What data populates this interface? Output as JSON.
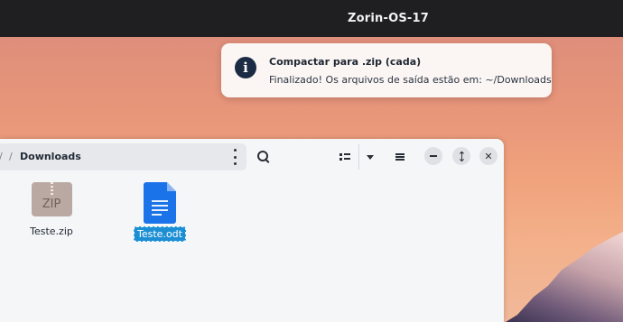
{
  "topbar": {
    "title": "Zorin-OS-17"
  },
  "notification": {
    "title": "Compactar para .zip (cada)",
    "body": "Finalizado! Os arquivos de saída estão em: ~/Downloads"
  },
  "file_manager": {
    "path": {
      "leading_separator": "/",
      "separator": "/",
      "current": "Downloads"
    },
    "files": [
      {
        "name": "Teste.zip",
        "type": "zip-archive",
        "icon": "zip-archive-icon",
        "icon_text": "ZIP",
        "selected": false
      },
      {
        "name": "Teste.odt",
        "type": "odt-document",
        "icon": "document-icon",
        "selected": true
      }
    ]
  },
  "colors": {
    "topbar": "#1f1f21",
    "selection": "#1c8fd4",
    "doc_icon": "#1a73e8",
    "info_icon": "#1c2b44"
  }
}
